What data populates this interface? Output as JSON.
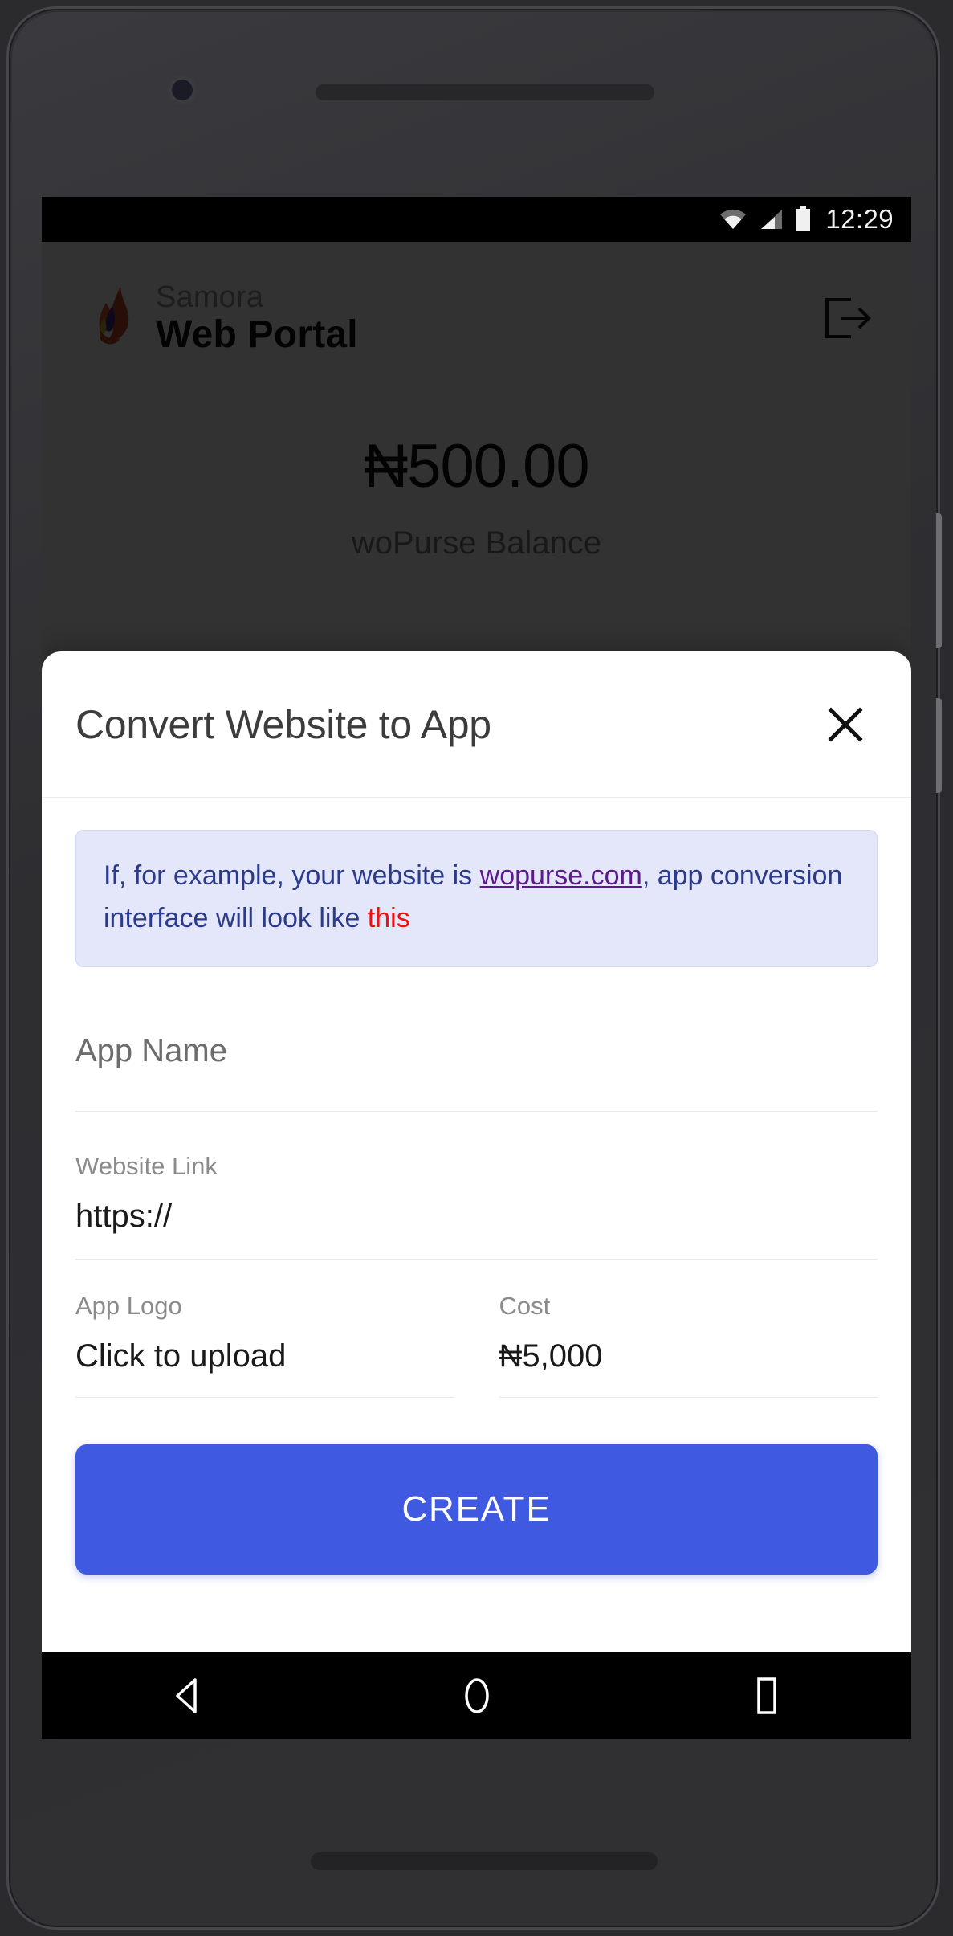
{
  "device": {
    "status_bar": {
      "time": "12:29",
      "icons": [
        "wifi-icon",
        "signal-icon",
        "battery-icon"
      ]
    },
    "nav_bar": {
      "back_label": "back-icon",
      "home_label": "home-icon",
      "recents_label": "recents-icon"
    }
  },
  "app": {
    "brand": {
      "top": "Samora",
      "bottom": "Web Portal",
      "logo_icon": "flame-logo-icon"
    },
    "logout_icon": "logout-icon",
    "balance": {
      "amount": "₦500.00",
      "label": "woPurse Balance"
    }
  },
  "modal": {
    "title": "Convert Website to App",
    "close_icon": "close-icon",
    "banner": {
      "lead": "If, for example, your website is ",
      "link": "wopurse.com",
      "middle": ", app conversion interface will look like ",
      "emphasis": "this"
    },
    "fields": {
      "app_name": {
        "placeholder": "App Name"
      },
      "website_link": {
        "label": "Website Link",
        "value": "https://"
      },
      "app_logo": {
        "label": "App Logo",
        "value": "Click to upload"
      },
      "cost": {
        "label": "Cost",
        "value": "₦5,000"
      }
    },
    "submit_label": "CREATE"
  },
  "colors": {
    "accent": "#3f5ae0",
    "banner_bg": "#e4e7fa",
    "banner_text": "#2c3a8c",
    "banner_link": "#5c1a8c",
    "banner_emphasis": "#f11010"
  }
}
